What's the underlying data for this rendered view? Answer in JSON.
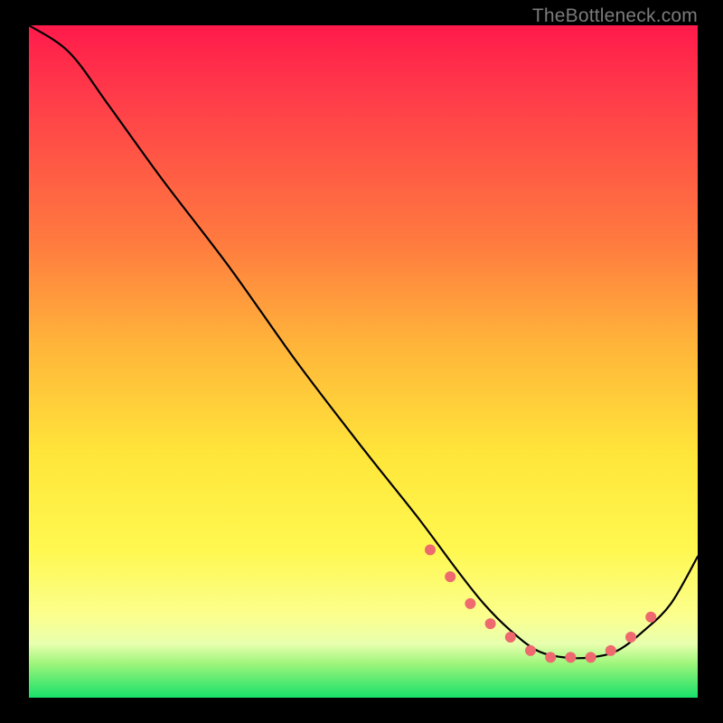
{
  "watermark": "TheBottleneck.com",
  "gradient": {
    "top": "#ff1a4b",
    "mid1": "#ff7a3f",
    "mid2": "#ffe63a",
    "mid3": "#fbff8f",
    "bottom": "#17e06a"
  },
  "chart_data": {
    "type": "line",
    "title": "",
    "xlabel": "",
    "ylabel": "",
    "xlim": [
      0,
      100
    ],
    "ylim": [
      0,
      100
    ],
    "curve": {
      "x": [
        0,
        6,
        12,
        20,
        30,
        40,
        50,
        58,
        64,
        68,
        72,
        76,
        80,
        84,
        88,
        92,
        96,
        100
      ],
      "y": [
        100,
        96,
        88,
        77,
        64,
        50,
        37,
        27,
        19,
        14,
        10,
        7,
        6,
        6,
        7,
        10,
        14,
        21
      ]
    },
    "markers": {
      "x": [
        60,
        63,
        66,
        69,
        72,
        75,
        78,
        81,
        84,
        87,
        90,
        93
      ],
      "y": [
        22,
        18,
        14,
        11,
        9,
        7,
        6,
        6,
        6,
        7,
        9,
        12
      ]
    },
    "annotations": []
  }
}
